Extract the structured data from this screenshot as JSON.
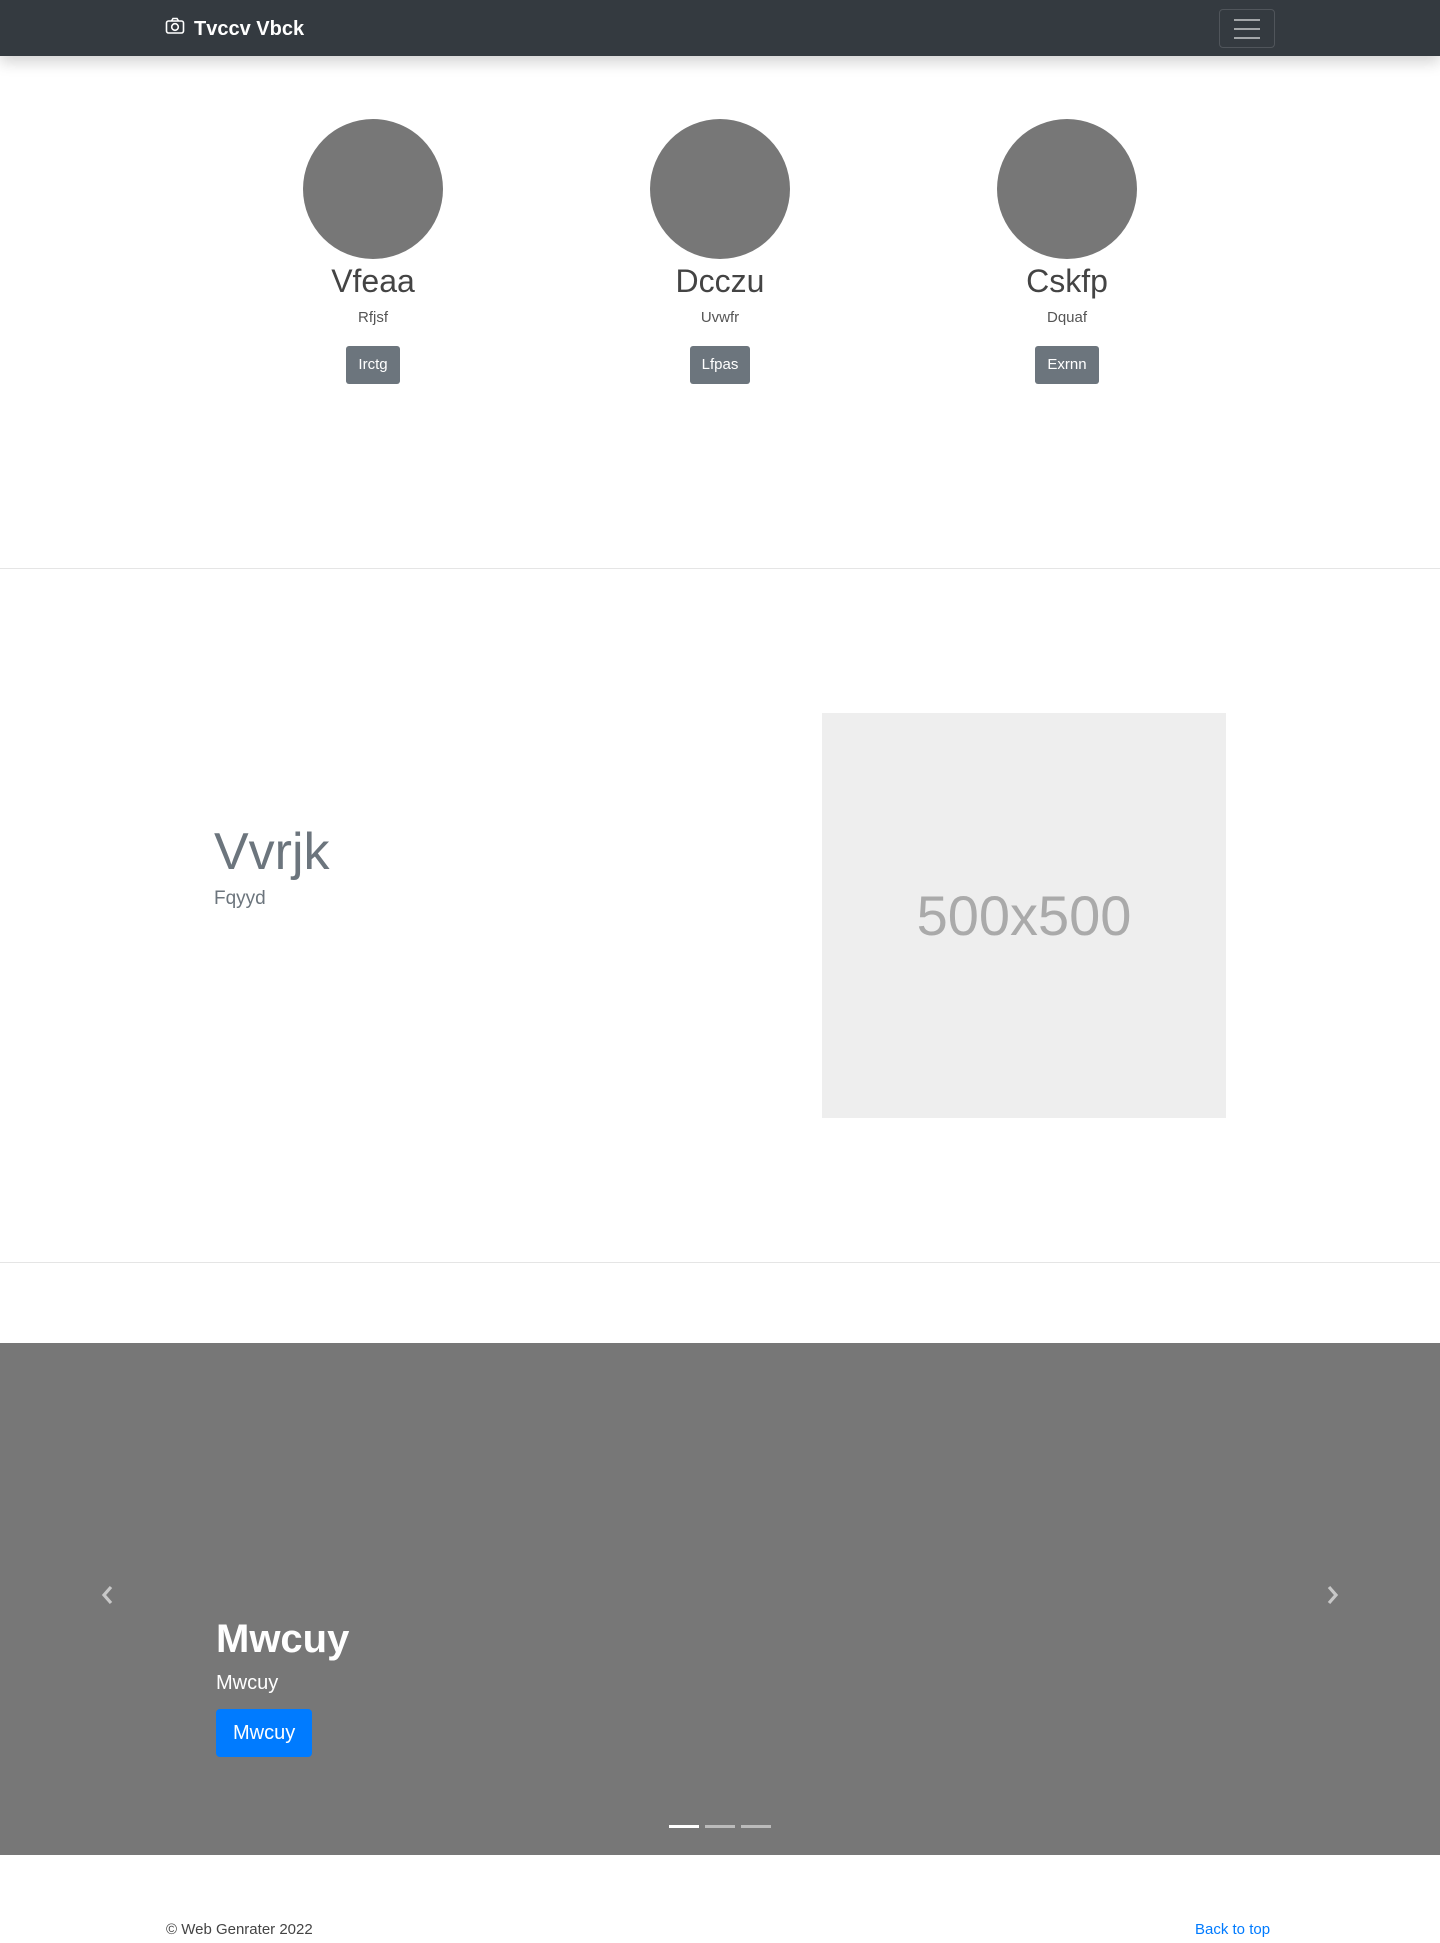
{
  "navbar": {
    "brand": "Tvccv Vbck",
    "brand_icon": "camera-icon",
    "toggler_icon": "hamburger-icon"
  },
  "team": [
    {
      "name": "Vfeaa",
      "role": "Rfjsf",
      "button": "Irctg"
    },
    {
      "name": "Dcczu",
      "role": "Uvwfr",
      "button": "Lfpas"
    },
    {
      "name": "Cskfp",
      "role": "Dquaf",
      "button": "Exrnn"
    }
  ],
  "feature": {
    "heading": "Vvrjk",
    "subheading": "Fqyyd",
    "image_label": "500x500"
  },
  "carousel": {
    "title": "Mwcuy",
    "text": "Mwcuy",
    "button": "Mwcuy",
    "slide_count": 3,
    "active_slide": 1,
    "prev_icon": "chevron-left-icon",
    "next_icon": "chevron-right-icon"
  },
  "footer": {
    "copyright": "© Web Genrater 2022",
    "back_to_top": "Back to top"
  },
  "colors": {
    "navbar_bg": "#343a40",
    "avatar": "#777777",
    "secondary_button": "#6c757d",
    "primary_button": "#007bff",
    "carousel_bg": "#777777",
    "placeholder_bg": "#eeeeee"
  }
}
